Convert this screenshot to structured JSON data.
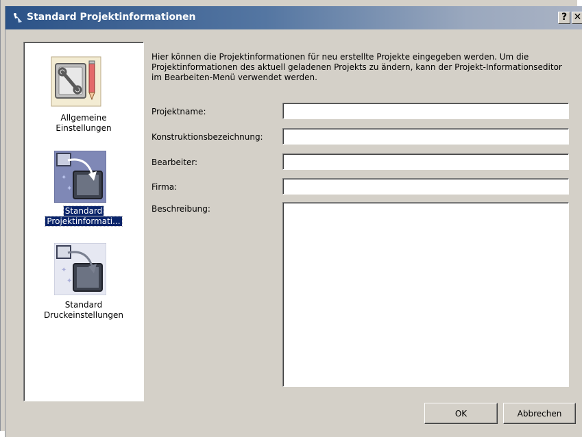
{
  "window": {
    "title": "Standard Projektinformationen",
    "help_label": "?",
    "close_label": "✕"
  },
  "nav": {
    "items": [
      {
        "label_line1": "Allgemeine",
        "label_line2": "Einstellungen",
        "icon": "wrench-pencil-icon",
        "selected": false
      },
      {
        "label_line1": "Standard",
        "label_line2": "Projektinformati...",
        "icon": "project-info-arrow-icon",
        "selected": true
      },
      {
        "label_line1": "Standard",
        "label_line2": "Druckeinstellungen",
        "icon": "print-settings-arrow-icon",
        "selected": false
      }
    ]
  },
  "main": {
    "info_text": "Hier können die Projektinformationen für neu erstellte Projekte eingegeben werden. Um die Projektinformationen des aktuell geladenen Projekts zu ändern, kann der Projekt-Informationseditor im Bearbeiten-Menü verwendet werden.",
    "fields": {
      "projektname": {
        "label": "Projektname:",
        "value": ""
      },
      "konstruktion": {
        "label": "Konstruktionsbezeichnung:",
        "value": ""
      },
      "bearbeiter": {
        "label": "Bearbeiter:",
        "value": ""
      },
      "firma": {
        "label": "Firma:",
        "value": ""
      },
      "beschreibung": {
        "label": "Beschreibung:",
        "value": ""
      }
    }
  },
  "buttons": {
    "ok_label": "OK",
    "cancel_label": "Abbrechen"
  },
  "colors": {
    "titlebar_start": "#2b5287",
    "selection": "#0a246a",
    "dialog_bg": "#d4d0c8"
  }
}
